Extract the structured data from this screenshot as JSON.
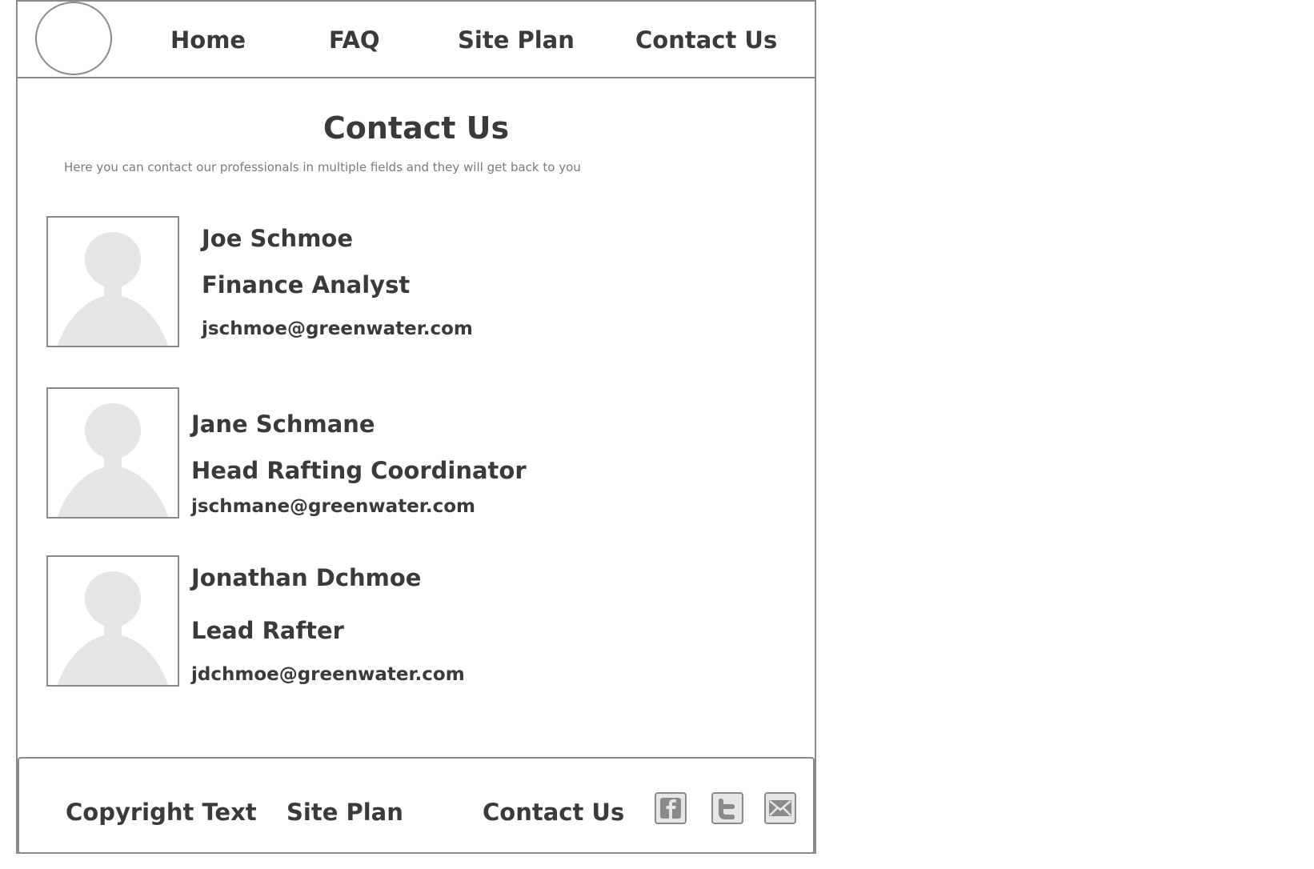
{
  "nav": {
    "home": "Home",
    "faq": "FAQ",
    "site_plan": "Site Plan",
    "contact_us": "Contact Us"
  },
  "page": {
    "title": "Contact Us",
    "subtitle": "Here you can contact our professionals in multiple fields and they will get back to you"
  },
  "contacts": [
    {
      "name": "Joe Schmoe",
      "role": "Finance Analyst",
      "email": "jschmoe@greenwater.com"
    },
    {
      "name": "Jane Schmane",
      "role": "Head Rafting Coordinator",
      "email": "jschmane@greenwater.com"
    },
    {
      "name": "Jonathan Dchmoe",
      "role": "Lead Rafter",
      "email": "jdchmoe@greenwater.com"
    }
  ],
  "footer": {
    "copyright": "Copyright Text",
    "site_plan": "Site Plan",
    "contact_us": "Contact Us",
    "social_icons": [
      "facebook-icon",
      "twitter-icon",
      "mail-icon"
    ]
  },
  "colors": {
    "border": "#8a8a8a",
    "text": "#3a3a3a",
    "placeholder": "#e6e6e6"
  }
}
